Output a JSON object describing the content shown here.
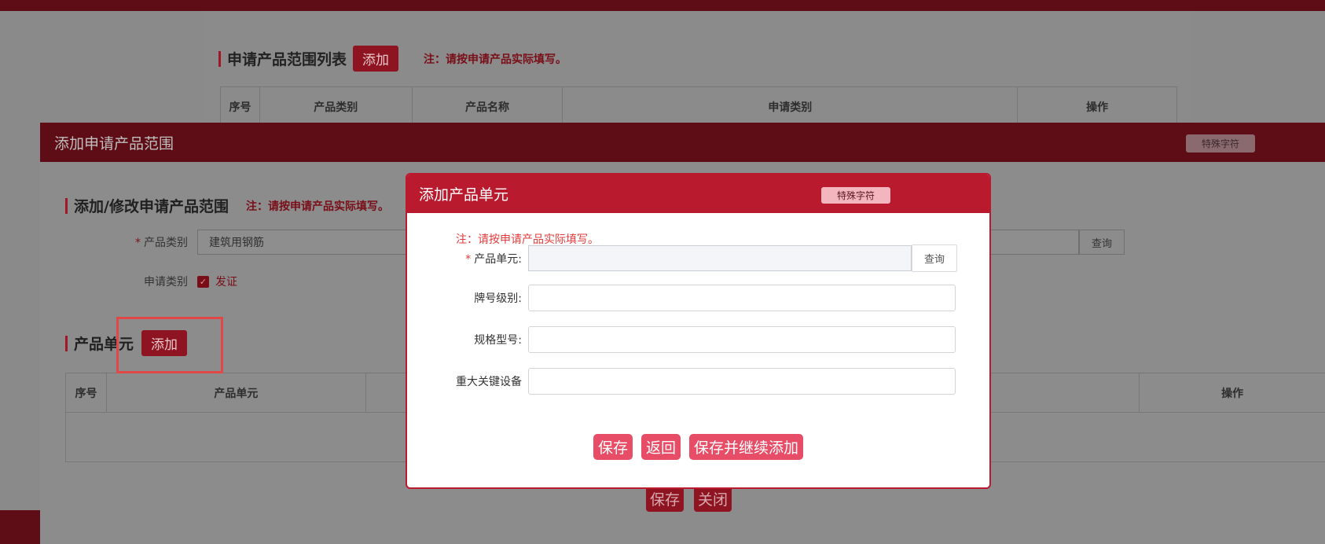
{
  "background_page": {
    "section_title": "申请产品范围列表",
    "add_label": "添加",
    "note": "注：请按申请产品实际填写。",
    "table_headers": [
      "序号",
      "产品类别",
      "产品名称",
      "申请类别",
      "操作"
    ]
  },
  "mid_dialog": {
    "title": "添加申请产品范围",
    "special_chars_badge": "特殊字符",
    "section_title": "添加/修改申请产品范围",
    "note": "注：请按申请产品实际填写。",
    "product_category_label": "产品类别",
    "product_category_value": "建筑用钢筋",
    "query_label": "查询",
    "apply_category_label": "申请类别",
    "apply_category_option": "发证",
    "product_unit_section": "产品单元",
    "add_label": "添加",
    "unit_table_headers": [
      "序号",
      "产品单元",
      "操作"
    ],
    "save_label": "保存",
    "close_label": "关闭"
  },
  "modal": {
    "title": "添加产品单元",
    "special_chars_badge": "特殊字符",
    "note": "注：请按申请产品实际填写。",
    "fields": {
      "product_unit_label": "产品单元:",
      "brand_grade_label": "牌号级别:",
      "spec_model_label": "规格型号:",
      "key_equipment_label": "重大关键设备"
    },
    "query_label": "查询",
    "buttons": {
      "save": "保存",
      "back": "返回",
      "save_continue": "保存并继续添加"
    }
  },
  "colors": {
    "accent": "#b91a2e",
    "button_light": "#e74d66",
    "highlight": "#e04747"
  }
}
